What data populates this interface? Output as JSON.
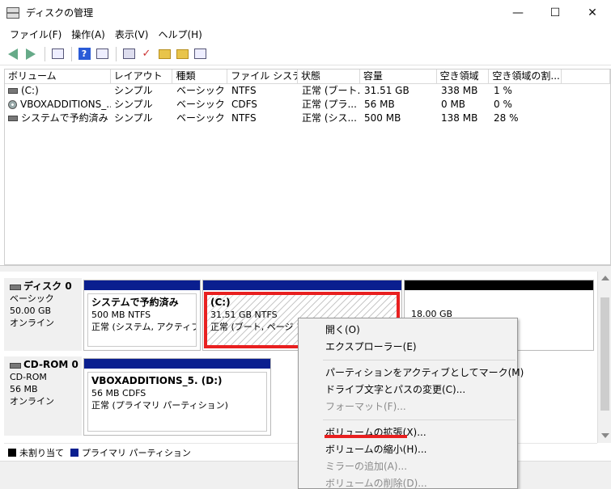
{
  "window": {
    "title": "ディスクの管理",
    "minimize": "—",
    "maximize": "☐",
    "close": "✕"
  },
  "menubar": [
    "ファイル(F)",
    "操作(A)",
    "表示(V)",
    "ヘルプ(H)"
  ],
  "toolbar_icons": [
    "back-arrow",
    "forward-arrow",
    "console-tree",
    "help",
    "show-pane",
    "connect-disk",
    "check",
    "folder-up",
    "folder-search",
    "properties"
  ],
  "volume_list": {
    "columns": [
      "ボリューム",
      "レイアウト",
      "種類",
      "ファイル システム",
      "状態",
      "容量",
      "空き領域",
      "空き領域の割...",
      ""
    ],
    "rows": [
      {
        "icon": "drive",
        "cells": [
          "(C:)",
          "シンプル",
          "ベーシック",
          "NTFS",
          "正常 (ブート...",
          "31.51 GB",
          "338 MB",
          "1 %"
        ]
      },
      {
        "icon": "cd",
        "cells": [
          "VBOXADDITIONS_...",
          "シンプル",
          "ベーシック",
          "CDFS",
          "正常 (プラ...",
          "56 MB",
          "0 MB",
          "0 %"
        ]
      },
      {
        "icon": "drive",
        "cells": [
          "システムで予約済み",
          "シンプル",
          "ベーシック",
          "NTFS",
          "正常 (シス...",
          "500 MB",
          "138 MB",
          "28 %"
        ]
      }
    ]
  },
  "disks": [
    {
      "name": "ディスク 0",
      "type": "ベーシック",
      "size": "50.00 GB",
      "status": "オンライン",
      "partitions": [
        {
          "name": "システムで予約済み",
          "size": "500 MB NTFS",
          "status": "正常 (システム, アクティブ, プ"
        },
        {
          "name": "(C:)",
          "size": "31.51 GB NTFS",
          "status": "正常 (ブート, ページ ファ"
        },
        {
          "name": "",
          "size": "18.00 GB",
          "status": ""
        }
      ]
    },
    {
      "name": "CD-ROM 0",
      "type": "CD-ROM",
      "size": "56 MB",
      "status": "オンライン",
      "partitions": [
        {
          "name": "VBOXADDITIONS_5. (D:)",
          "size": "56 MB CDFS",
          "status": "正常 (プライマリ パーティション)"
        }
      ]
    }
  ],
  "legend": {
    "unallocated": "未割り当て",
    "primary": "プライマリ パーティション"
  },
  "colors": {
    "primary": "#0a1f8f",
    "unallocated": "#000000",
    "highlight": "#e82020"
  },
  "context_menu": {
    "items": [
      {
        "label": "開く(O)",
        "disabled": false
      },
      {
        "label": "エクスプローラー(E)",
        "disabled": false
      },
      {
        "label": "パーティションをアクティブとしてマーク(M)",
        "disabled": false
      },
      {
        "label": "ドライブ文字とパスの変更(C)...",
        "disabled": false
      },
      {
        "label": "フォーマット(F)...",
        "disabled": true
      },
      {
        "label": "ボリュームの拡張(X)...",
        "disabled": false
      },
      {
        "label": "ボリュームの縮小(H)...",
        "disabled": false
      },
      {
        "label": "ミラーの追加(A)...",
        "disabled": true
      },
      {
        "label": "ボリュームの削除(D)...",
        "disabled": true
      }
    ]
  }
}
